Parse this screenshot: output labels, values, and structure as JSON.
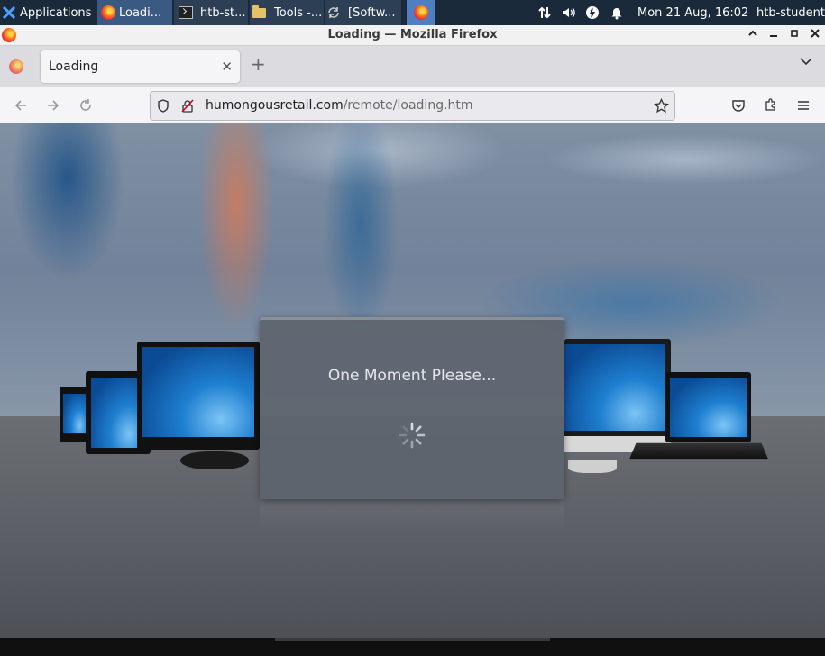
{
  "panel": {
    "apps_label": "Applications",
    "tasks": [
      "Loadi...",
      "htb-st...",
      "Tools -...",
      "[Softw..."
    ],
    "clock": "Mon 21 Aug, 16:02",
    "user": "htb-student"
  },
  "window": {
    "title": "Loading — Mozilla Firefox"
  },
  "browser": {
    "tab_label": "Loading",
    "url_host": "humongousretail.com",
    "url_path": "/remote/loading.htm"
  },
  "page": {
    "loading_message": "One Moment Please..."
  },
  "colors": {
    "panel_bg": "#1b2a3b",
    "panel_active": "#4d7fc2",
    "overlay_bg": "#5e646e"
  }
}
